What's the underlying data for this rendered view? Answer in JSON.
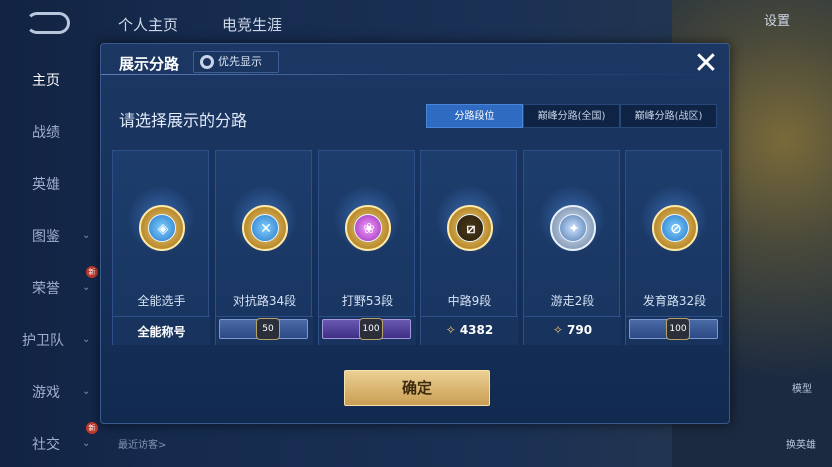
{
  "topbar": {
    "tabs": [
      "个人主页",
      "电竞生涯"
    ],
    "settings_label": "设置"
  },
  "sidebar": {
    "items": [
      {
        "label": "主页",
        "active": true,
        "chevron": false
      },
      {
        "label": "战绩",
        "active": false,
        "chevron": false
      },
      {
        "label": "英雄",
        "active": false,
        "chevron": false
      },
      {
        "label": "图鉴",
        "active": false,
        "chevron": true
      },
      {
        "label": "荣誉",
        "active": false,
        "chevron": true,
        "badge": "新"
      },
      {
        "label": "护卫队",
        "active": false,
        "chevron": true
      },
      {
        "label": "游戏",
        "active": false,
        "chevron": true
      },
      {
        "label": "社交",
        "active": false,
        "chevron": true,
        "badge": "新"
      }
    ],
    "recent_visitors": "最近访客>"
  },
  "modal": {
    "title": "展示分路",
    "priority_label": "优先显示",
    "close_glyph": "✕",
    "subtitle": "请选择展示的分路",
    "segments": [
      {
        "label": "分路段位",
        "active": true
      },
      {
        "label": "巅峰分路(全国)",
        "active": false
      },
      {
        "label": "巅峰分路(战区)",
        "active": false
      }
    ],
    "cards": [
      {
        "label": "全能选手",
        "icon": "all-round-icon",
        "glyph": "◈",
        "style": "",
        "footer_type": "text",
        "footer": "全能称号"
      },
      {
        "label": "对抗路34段",
        "icon": "clash-lane-icon",
        "glyph": "✕",
        "style": "",
        "footer_type": "ribbon",
        "footer": "50"
      },
      {
        "label": "打野53段",
        "icon": "jungle-icon",
        "glyph": "❀",
        "style": "purple",
        "footer_type": "ribbon-purple",
        "footer": "100"
      },
      {
        "label": "中路9段",
        "icon": "mid-lane-icon",
        "glyph": "⧄",
        "style": "gold",
        "footer_type": "mark",
        "footer": "4382"
      },
      {
        "label": "游走2段",
        "icon": "roam-icon",
        "glyph": "✦",
        "style": "silver",
        "footer_type": "mark",
        "footer": "790"
      },
      {
        "label": "发育路32段",
        "icon": "farm-lane-icon",
        "glyph": "⊘",
        "style": "",
        "footer_type": "ribbon",
        "footer": "100"
      }
    ],
    "confirm_label": "确定"
  },
  "bottom_right": {
    "item1": "模型",
    "item2": "换英雄"
  }
}
